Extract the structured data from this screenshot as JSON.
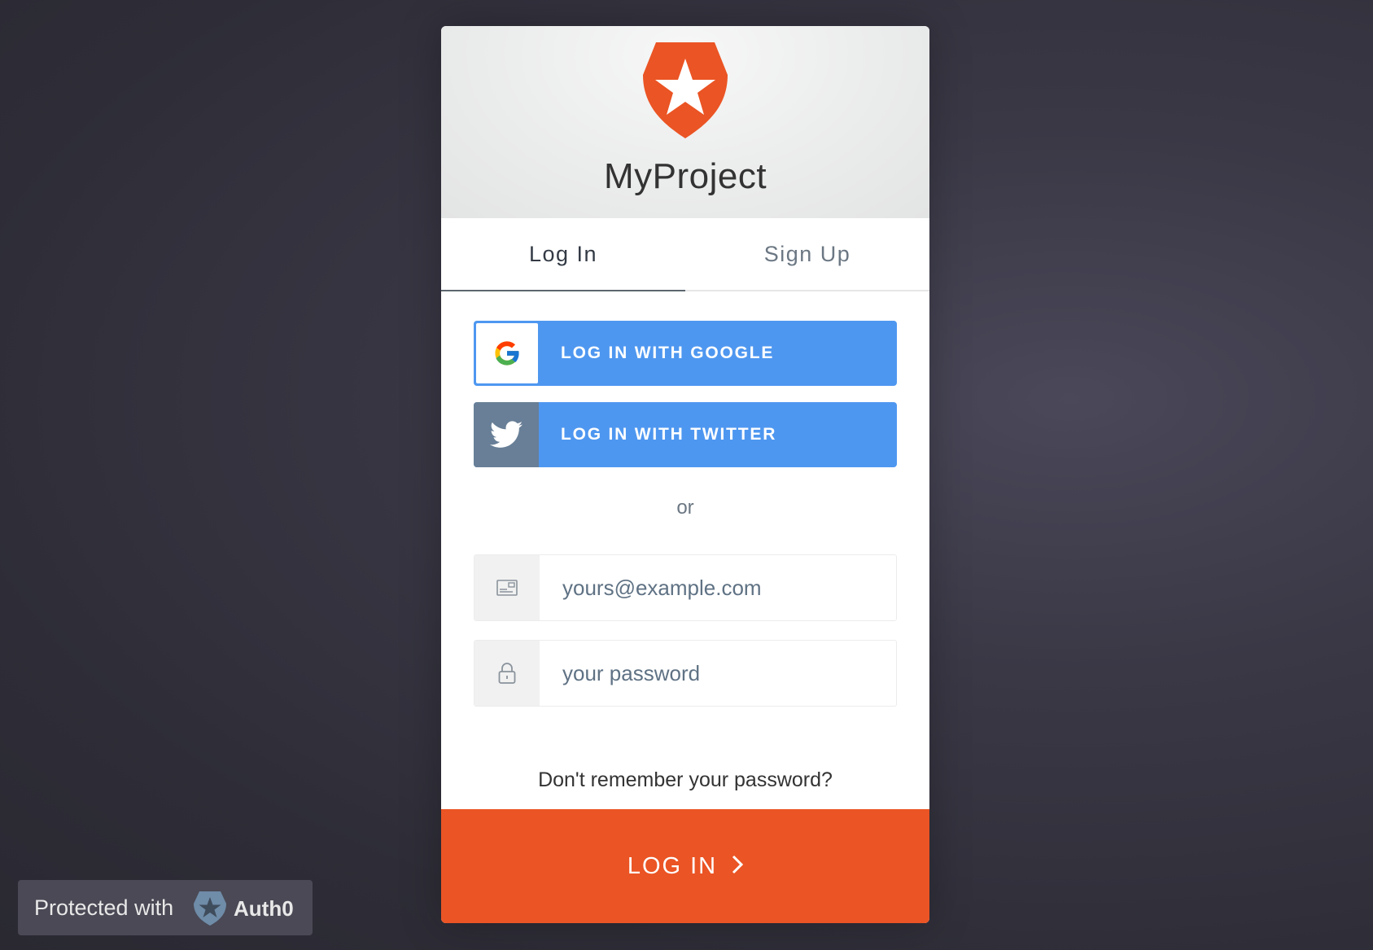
{
  "app": {
    "title": "MyProject",
    "logo_icon": "auth0-shield-star-icon",
    "brand_color": "#eb5424"
  },
  "tabs": [
    {
      "label": "Log In",
      "active": true
    },
    {
      "label": "Sign Up",
      "active": false
    }
  ],
  "social": {
    "google": {
      "label": "LOG IN WITH GOOGLE",
      "icon": "google-icon",
      "color": "#4e97f0"
    },
    "twitter": {
      "label": "LOG IN WITH TWITTER",
      "icon": "twitter-bird-icon",
      "color": "#4e97f0"
    }
  },
  "divider_text": "or",
  "form": {
    "email_placeholder": "yours@example.com",
    "email_icon": "email-card-icon",
    "password_placeholder": "your password",
    "password_icon": "lock-icon"
  },
  "forgot_password": "Don't remember your password?",
  "submit": {
    "label": "LOG IN",
    "icon": "chevron-right-icon"
  },
  "footer_badge": {
    "text": "Protected with",
    "brand": "Auth0",
    "icon": "auth0-star-icon"
  }
}
